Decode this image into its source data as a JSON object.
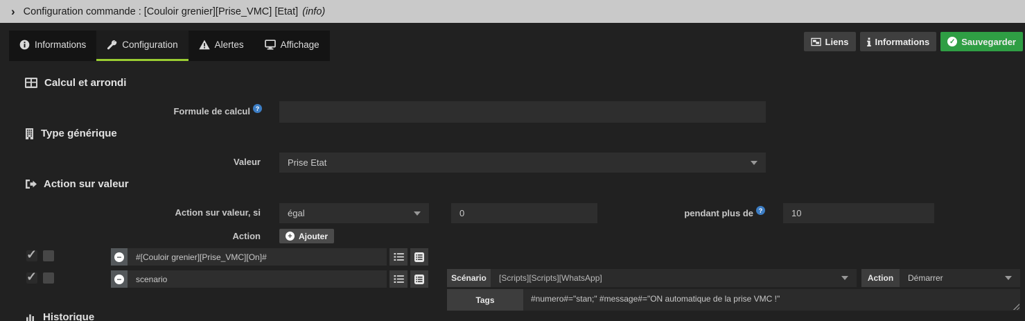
{
  "header": {
    "chevron": "›",
    "title": "Configuration commande : [Couloir grenier][Prise_VMC] [Etat]",
    "suffix": "(info)"
  },
  "tabs": [
    {
      "label": "Informations",
      "icon": "info-circle-icon",
      "active": false
    },
    {
      "label": "Configuration",
      "icon": "wrench-icon",
      "active": true
    },
    {
      "label": "Alertes",
      "icon": "warning-triangle-icon",
      "active": false
    },
    {
      "label": "Affichage",
      "icon": "display-icon",
      "active": false
    }
  ],
  "toolbar": {
    "liens": "Liens",
    "informations": "Informations",
    "sauvegarder": "Sauvegarder",
    "save_check_glyph": "✓"
  },
  "sections": {
    "calcul": "Calcul et arrondi",
    "type_generique": "Type générique",
    "action_valeur": "Action sur valeur",
    "historique": "Historique"
  },
  "form": {
    "formule_label": "Formule de calcul",
    "formule_value": "",
    "help_glyph": "?",
    "valeur_label": "Valeur",
    "valeur_value": "Prise Etat",
    "condition_label": "Action sur valeur, si",
    "condition_value": "égal",
    "seuil_value": "0",
    "pendant_label": "pendant plus de",
    "pendant_value": "10",
    "action_label": "Action",
    "ajouter": "Ajouter",
    "plus_glyph": "+",
    "minus_glyph": "−",
    "check_glyph": "✓"
  },
  "action_rows": [
    {
      "command": "#[Couloir grenier][Prise_VMC][On]#",
      "checked": true
    },
    {
      "command": "scenario",
      "checked": true
    }
  ],
  "scenario_panel": {
    "scenario_label": "Scénario",
    "scenario_value": "[Scripts][Scripts][WhatsApp]",
    "action_label": "Action",
    "action_value": "Démarrer",
    "tags_label": "Tags",
    "tags_value": "#numero#=\"stan;\" #message#=\"ON automatique de la prise VMC !\""
  },
  "colors": {
    "accent_green": "#9ACD32",
    "save_green": "#2F9E44",
    "help_blue": "#3C7DC4",
    "topbar_gray": "#C9C9C9",
    "page_bg": "#212121",
    "input_bg": "#2E2E2E",
    "addon_bg": "#3D3D3D"
  }
}
